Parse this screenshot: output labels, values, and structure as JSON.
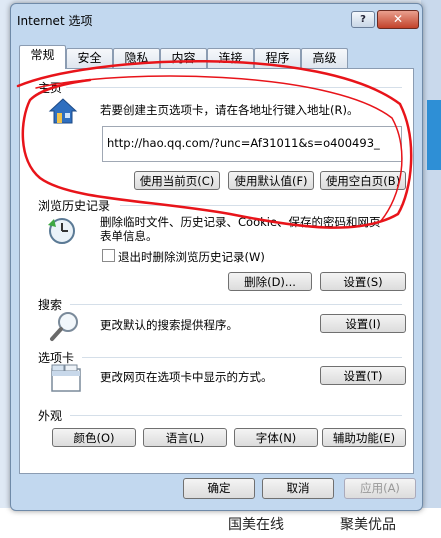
{
  "background": {
    "links": [
      "国美在线",
      "聚美优品"
    ]
  },
  "dialog": {
    "title": "Internet 选项",
    "help_label": "?",
    "close_label": "✕"
  },
  "tabs": [
    {
      "label": "常规"
    },
    {
      "label": "安全"
    },
    {
      "label": "隐私"
    },
    {
      "label": "内容"
    },
    {
      "label": "连接"
    },
    {
      "label": "程序"
    },
    {
      "label": "高级"
    }
  ],
  "homepage": {
    "title": "主页",
    "description": "若要创建主页选项卡，请在各地址行键入地址(R)。",
    "url": "http://hao.qq.com/?unc=Af31011&s=o400493_",
    "btn_current": "使用当前页(C)",
    "btn_default": "使用默认值(F)",
    "btn_blank": "使用空白页(B)"
  },
  "history": {
    "title": "浏览历史记录",
    "description_line1": "删除临时文件、历史记录、Cookie、保存的密码和网页",
    "description_line2": "表单信息。",
    "checkbox_label": "退出时删除浏览历史记录(W)",
    "checkbox_checked": false,
    "btn_delete": "删除(D)...",
    "btn_settings": "设置(S)"
  },
  "search": {
    "title": "搜索",
    "description": "更改默认的搜索提供程序。",
    "btn_settings": "设置(I)"
  },
  "tabs_section": {
    "title": "选项卡",
    "description": "更改网页在选项卡中显示的方式。",
    "btn_settings": "设置(T)"
  },
  "appearance": {
    "title": "外观",
    "btn_colors": "颜色(O)",
    "btn_languages": "语言(L)",
    "btn_fonts": "字体(N)",
    "btn_accessibility": "辅助功能(E)"
  },
  "footer": {
    "btn_ok": "确定",
    "btn_cancel": "取消",
    "btn_apply": "应用(A)"
  },
  "colors": {
    "annotation_red": "#e8141a"
  }
}
